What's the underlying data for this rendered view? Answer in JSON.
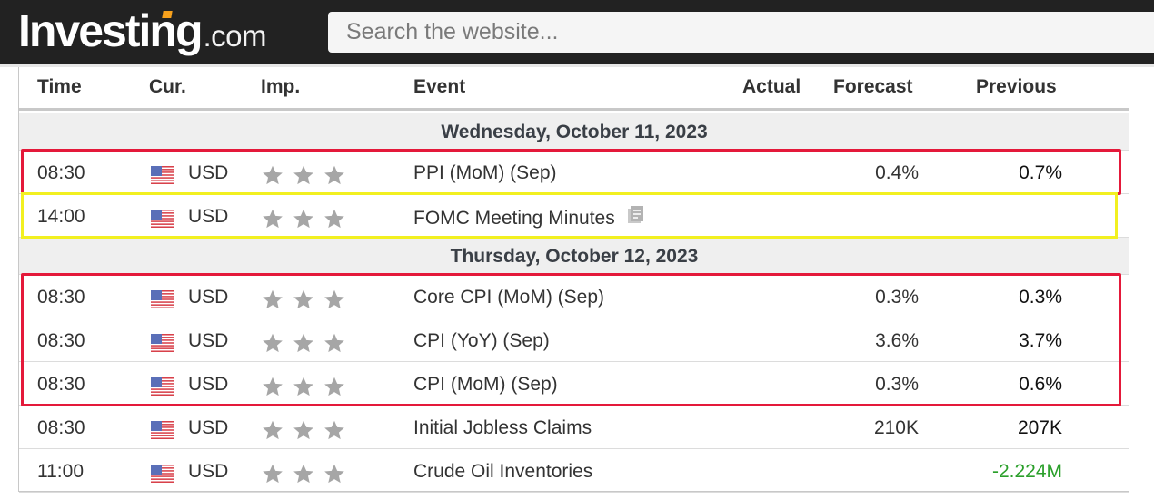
{
  "header": {
    "logo_main": "Investing",
    "logo_suffix": ".com",
    "search_placeholder": "Search the website..."
  },
  "table": {
    "columns": {
      "time": "Time",
      "currency": "Cur.",
      "importance": "Imp.",
      "event": "Event",
      "actual": "Actual",
      "forecast": "Forecast",
      "previous": "Previous"
    },
    "days": [
      {
        "label": "Wednesday, October 11, 2023",
        "events": [
          {
            "time": "08:30",
            "currency": "USD",
            "flag": "us-flag-icon",
            "importance": 3,
            "event": "PPI (MoM) (Sep)",
            "actual": "",
            "forecast": "0.4%",
            "previous": "0.7%",
            "highlight": "red"
          },
          {
            "time": "14:00",
            "currency": "USD",
            "flag": "us-flag-icon",
            "importance": 3,
            "event": "FOMC Meeting Minutes",
            "event_icon": "document-icon",
            "actual": "",
            "forecast": "",
            "previous": "",
            "highlight": "yellow"
          }
        ]
      },
      {
        "label": "Thursday, October 12, 2023",
        "events": [
          {
            "time": "08:30",
            "currency": "USD",
            "flag": "us-flag-icon",
            "importance": 3,
            "event": "Core CPI (MoM) (Sep)",
            "actual": "",
            "forecast": "0.3%",
            "previous": "0.3%",
            "highlight": "red"
          },
          {
            "time": "08:30",
            "currency": "USD",
            "flag": "us-flag-icon",
            "importance": 3,
            "event": "CPI (YoY) (Sep)",
            "actual": "",
            "forecast": "3.6%",
            "previous": "3.7%",
            "highlight": "red"
          },
          {
            "time": "08:30",
            "currency": "USD",
            "flag": "us-flag-icon",
            "importance": 3,
            "event": "CPI (MoM) (Sep)",
            "actual": "",
            "forecast": "0.3%",
            "previous": "0.6%",
            "highlight": "red"
          },
          {
            "time": "08:30",
            "currency": "USD",
            "flag": "us-flag-icon",
            "importance": 3,
            "event": "Initial Jobless Claims",
            "actual": "",
            "forecast": "210K",
            "previous": "207K"
          },
          {
            "time": "11:00",
            "currency": "USD",
            "flag": "us-flag-icon",
            "importance": 3,
            "event": "Crude Oil Inventories",
            "actual": "",
            "forecast": "",
            "previous": "-2.224M",
            "previous_color": "#2a9f2a"
          }
        ]
      }
    ]
  },
  "colors": {
    "topbar": "#222222",
    "logo_accent": "#f7a11c",
    "highlight_red": "#e4193a",
    "highlight_yellow": "#f2f020",
    "star_gray": "#a6a6a6",
    "positive_green": "#2a9f2a"
  }
}
